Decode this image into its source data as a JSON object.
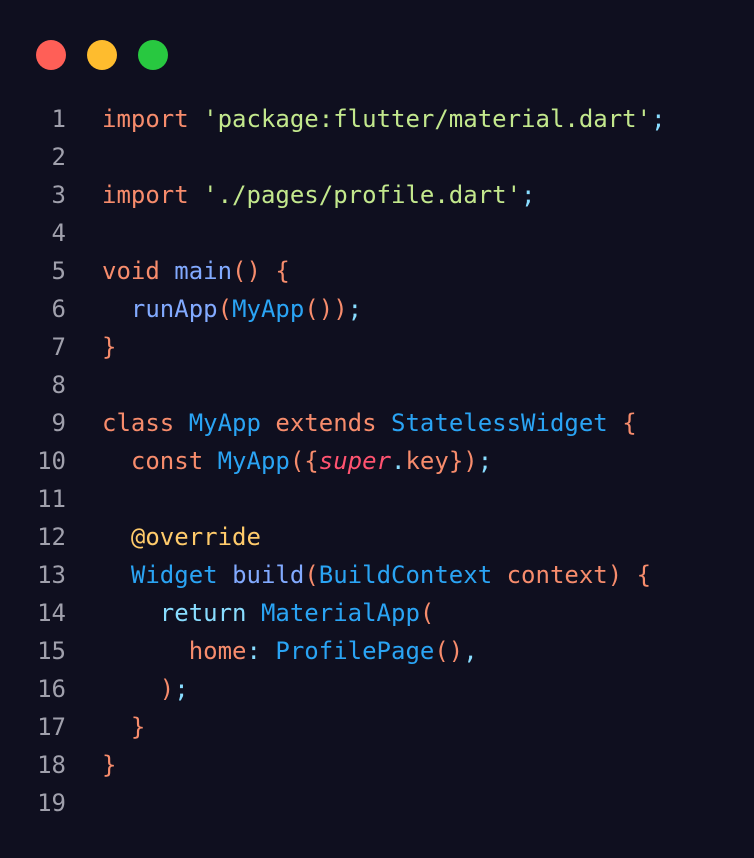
{
  "window": {
    "controls": [
      {
        "name": "close",
        "color": "#ff5f57"
      },
      {
        "name": "minimize",
        "color": "#febc2e"
      },
      {
        "name": "maximize",
        "color": "#28c840"
      }
    ]
  },
  "colors": {
    "background": "#0f0f1f",
    "line_number": "#a0a0ac",
    "keyword": "#f78c6c",
    "string": "#c3e88d",
    "punctuation": "#89ddff",
    "function": "#82aaff",
    "type": "#2aa4f4",
    "annotation": "#ffcb6b",
    "super": "#ff5370"
  },
  "code": {
    "lines": [
      {
        "number": "1",
        "tokens": [
          {
            "t": "import",
            "c": "keyword"
          },
          {
            "t": " ",
            "c": "plain"
          },
          {
            "t": "'package:flutter/material.dart'",
            "c": "string"
          },
          {
            "t": ";",
            "c": "punct"
          }
        ]
      },
      {
        "number": "2",
        "tokens": []
      },
      {
        "number": "3",
        "tokens": [
          {
            "t": "import",
            "c": "keyword"
          },
          {
            "t": " ",
            "c": "plain"
          },
          {
            "t": "'./pages/profile.dart'",
            "c": "string"
          },
          {
            "t": ";",
            "c": "punct"
          }
        ]
      },
      {
        "number": "4",
        "tokens": []
      },
      {
        "number": "5",
        "tokens": [
          {
            "t": "void",
            "c": "keyword"
          },
          {
            "t": " ",
            "c": "plain"
          },
          {
            "t": "main",
            "c": "func"
          },
          {
            "t": "()",
            "c": "brace"
          },
          {
            "t": " ",
            "c": "plain"
          },
          {
            "t": "{",
            "c": "brace"
          }
        ]
      },
      {
        "number": "6",
        "tokens": [
          {
            "t": "  ",
            "c": "plain"
          },
          {
            "t": "runApp",
            "c": "func"
          },
          {
            "t": "(",
            "c": "brace"
          },
          {
            "t": "MyApp",
            "c": "type"
          },
          {
            "t": "())",
            "c": "brace"
          },
          {
            "t": ";",
            "c": "punct"
          }
        ]
      },
      {
        "number": "7",
        "tokens": [
          {
            "t": "}",
            "c": "brace"
          }
        ]
      },
      {
        "number": "8",
        "tokens": []
      },
      {
        "number": "9",
        "tokens": [
          {
            "t": "class",
            "c": "keyword"
          },
          {
            "t": " ",
            "c": "plain"
          },
          {
            "t": "MyApp",
            "c": "type"
          },
          {
            "t": " ",
            "c": "plain"
          },
          {
            "t": "extends",
            "c": "keyword"
          },
          {
            "t": " ",
            "c": "plain"
          },
          {
            "t": "StatelessWidget",
            "c": "type"
          },
          {
            "t": " ",
            "c": "plain"
          },
          {
            "t": "{",
            "c": "brace"
          }
        ]
      },
      {
        "number": "10",
        "tokens": [
          {
            "t": "  ",
            "c": "plain"
          },
          {
            "t": "const",
            "c": "keyword"
          },
          {
            "t": " ",
            "c": "plain"
          },
          {
            "t": "MyApp",
            "c": "type"
          },
          {
            "t": "({",
            "c": "brace"
          },
          {
            "t": "super",
            "c": "super"
          },
          {
            "t": ".",
            "c": "punct"
          },
          {
            "t": "key",
            "c": "param"
          },
          {
            "t": "})",
            "c": "brace"
          },
          {
            "t": ";",
            "c": "punct"
          }
        ]
      },
      {
        "number": "11",
        "tokens": []
      },
      {
        "number": "12",
        "tokens": [
          {
            "t": "  ",
            "c": "plain"
          },
          {
            "t": "@override",
            "c": "annotation"
          }
        ]
      },
      {
        "number": "13",
        "tokens": [
          {
            "t": "  ",
            "c": "plain"
          },
          {
            "t": "Widget",
            "c": "type"
          },
          {
            "t": " ",
            "c": "plain"
          },
          {
            "t": "build",
            "c": "func"
          },
          {
            "t": "(",
            "c": "brace"
          },
          {
            "t": "BuildContext",
            "c": "type"
          },
          {
            "t": " ",
            "c": "plain"
          },
          {
            "t": "context",
            "c": "param"
          },
          {
            "t": ")",
            "c": "brace"
          },
          {
            "t": " ",
            "c": "plain"
          },
          {
            "t": "{",
            "c": "brace"
          }
        ]
      },
      {
        "number": "14",
        "tokens": [
          {
            "t": "    ",
            "c": "plain"
          },
          {
            "t": "return",
            "c": "return"
          },
          {
            "t": " ",
            "c": "plain"
          },
          {
            "t": "MaterialApp",
            "c": "type"
          },
          {
            "t": "(",
            "c": "brace"
          }
        ]
      },
      {
        "number": "15",
        "tokens": [
          {
            "t": "      ",
            "c": "plain"
          },
          {
            "t": "home",
            "c": "param"
          },
          {
            "t": ":",
            "c": "punct"
          },
          {
            "t": " ",
            "c": "plain"
          },
          {
            "t": "ProfilePage",
            "c": "type"
          },
          {
            "t": "()",
            "c": "brace"
          },
          {
            "t": ",",
            "c": "punct"
          }
        ]
      },
      {
        "number": "16",
        "tokens": [
          {
            "t": "    ",
            "c": "plain"
          },
          {
            "t": ")",
            "c": "brace"
          },
          {
            "t": ";",
            "c": "punct"
          }
        ]
      },
      {
        "number": "17",
        "tokens": [
          {
            "t": "  ",
            "c": "plain"
          },
          {
            "t": "}",
            "c": "brace"
          }
        ]
      },
      {
        "number": "18",
        "tokens": [
          {
            "t": "}",
            "c": "brace"
          }
        ]
      },
      {
        "number": "19",
        "tokens": []
      }
    ]
  }
}
